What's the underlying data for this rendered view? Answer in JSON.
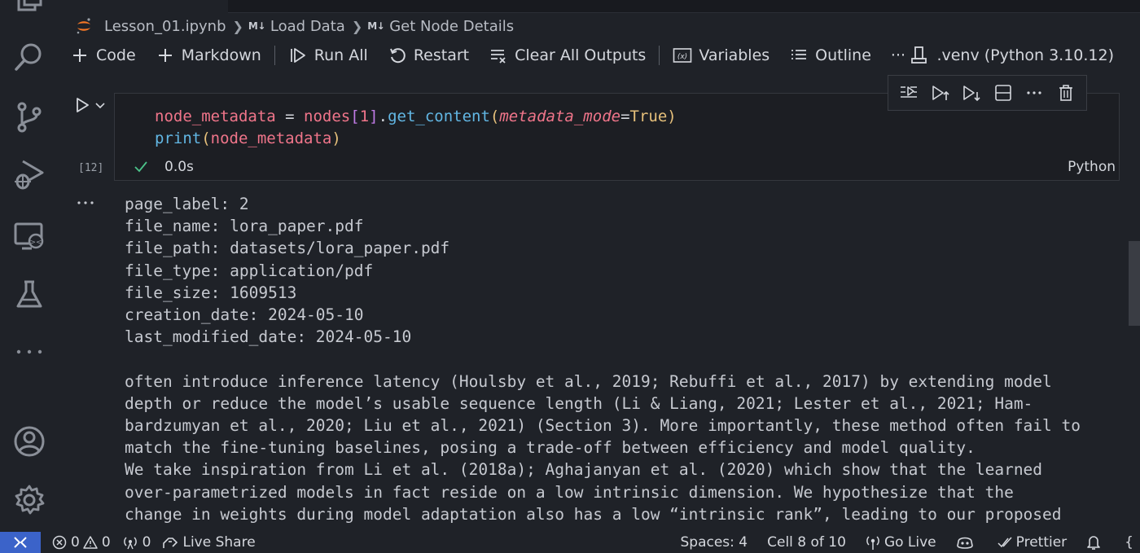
{
  "breadcrumb": {
    "file": "Lesson_01.ipynb",
    "md_badge": "M↓",
    "section1": "Load Data",
    "section2": "Get Node Details"
  },
  "toolbar": {
    "code": "Code",
    "markdown": "Markdown",
    "run_all": "Run All",
    "restart": "Restart",
    "clear_outputs": "Clear All Outputs",
    "variables": "Variables",
    "outline": "Outline",
    "more": "···",
    "kernel": ".venv (Python 3.10.12)"
  },
  "cell": {
    "code_line1": {
      "var": "node_metadata",
      "eq": " = ",
      "obj": "nodes",
      "lb": "[",
      "idx": "1",
      "rb": "]",
      "dot": ".",
      "fn": "get_content",
      "lp": "(",
      "kw": "metadata_mode",
      "assign": "=",
      "val": "True",
      "rp": ")"
    },
    "code_line2": {
      "fn": "print",
      "lp": "(",
      "arg": "node_metadata",
      "rp": ")"
    },
    "exec_count": "[12]",
    "exec_time": "0.0s",
    "language": "Python"
  },
  "output": {
    "lines": [
      "page_label: 2",
      "file_name: lora_paper.pdf",
      "file_path: datasets/lora_paper.pdf",
      "file_type: application/pdf",
      "file_size: 1609513",
      "creation_date: 2024-05-10",
      "last_modified_date: 2024-05-10",
      "",
      "often introduce inference latency (Houlsby et al., 2019; Rebuffi et al., 2017) by extending model",
      "depth or reduce the model’s usable sequence length (Li & Liang, 2021; Lester et al., 2021; Ham-",
      "bardzumyan et al., 2020; Liu et al., 2021) (Section 3). More importantly, these method often fail to",
      "match the fine-tuning baselines, posing a trade-off between efficiency and model quality.",
      "We take inspiration from Li et al. (2018a); Aghajanyan et al. (2020) which show that the learned",
      "over-parametrized models in fact reside on a low intrinsic dimension. We hypothesize that the",
      "change in weights during model adaptation also has a low “intrinsic rank”, leading to our proposed"
    ]
  },
  "statusbar": {
    "errors": "0",
    "warnings": "0",
    "ports": "0",
    "live_share": "Live Share",
    "spaces": "Spaces: 4",
    "cell_pos": "Cell 8 of 10",
    "go_live": "Go Live",
    "prettier": "Prettier",
    "braces": "{"
  },
  "colors": {
    "accent": "#3b63c9",
    "success": "#4cc38a",
    "background": "#1f2228"
  }
}
